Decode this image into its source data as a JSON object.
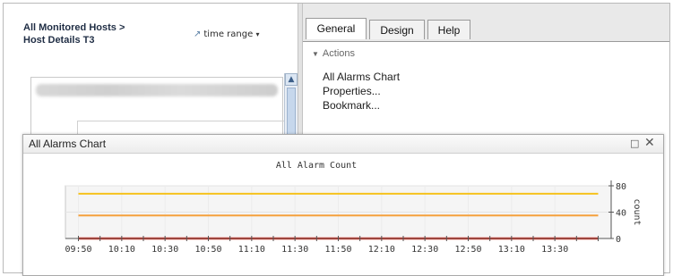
{
  "breadcrumb": {
    "line1": "All Monitored Hosts >",
    "line2": "Host Details T3"
  },
  "time_range": {
    "label": "time range",
    "icon": "clock-arrow-icon",
    "caret": "▾"
  },
  "tabs": [
    {
      "label": "General",
      "active": true
    },
    {
      "label": "Design",
      "active": false
    },
    {
      "label": "Help",
      "active": false
    }
  ],
  "actions": {
    "header": "Actions",
    "items": [
      "All Alarms Chart",
      "Properties...",
      "Bookmark..."
    ]
  },
  "chart_window": {
    "title": "All Alarms Chart",
    "max_icon": "□",
    "close_icon": "✕"
  },
  "chart_data": {
    "type": "line",
    "title": "All Alarm Count",
    "xlabel": "",
    "ylabel": "count",
    "x_ticks": [
      "09:50",
      "10:10",
      "10:30",
      "10:50",
      "11:10",
      "11:30",
      "11:50",
      "12:10",
      "12:30",
      "12:50",
      "13:10",
      "13:30"
    ],
    "y_ticks": [
      0,
      40,
      80
    ],
    "ylim": [
      0,
      80
    ],
    "grid": true,
    "y_axis_side": "right",
    "x_range": [
      "09:44",
      "13:56"
    ],
    "series": [
      {
        "color": "#f6c21c",
        "x": [
          "09:50",
          "13:50"
        ],
        "values": [
          68,
          68
        ]
      },
      {
        "color": "#f5a03c",
        "x": [
          "09:50",
          "13:50"
        ],
        "values": [
          35,
          35
        ]
      },
      {
        "color": "#e53527",
        "x": [
          "09:50",
          "13:50"
        ],
        "values": [
          0,
          0
        ]
      }
    ]
  }
}
